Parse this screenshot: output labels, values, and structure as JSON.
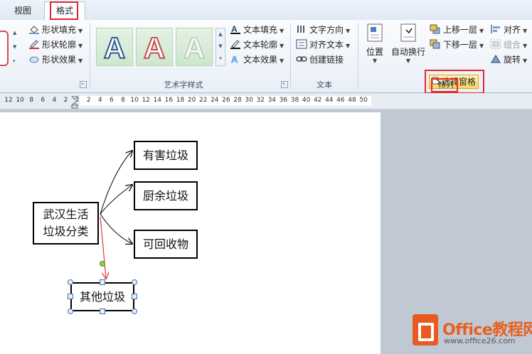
{
  "tabs": {
    "view": "视图",
    "format": "格式"
  },
  "shape_styles": {
    "fill": "形状填充",
    "outline": "形状轮廓",
    "effects": "形状效果"
  },
  "wordart": {
    "group_label": "艺术字样式",
    "sample": "A",
    "text_fill": "文本填充",
    "text_outline": "文本轮廓",
    "text_effects": "文本效果"
  },
  "text_group": {
    "direction": "文字方向",
    "align": "对齐文本",
    "link": "创建链接",
    "group_label": "文本"
  },
  "arrange": {
    "position": "位置",
    "wrap": "自动换行",
    "bring_forward": "上移一层",
    "send_backward": "下移一层",
    "selection_pane": "选择窗格",
    "align": "对齐",
    "group": "组合",
    "rotate": "旋转",
    "group_label": "排列"
  },
  "ruler": {
    "numbers": [
      "12",
      "10",
      "8",
      "6",
      "4",
      "2",
      "2",
      "2",
      "4",
      "6",
      "8",
      "10",
      "12",
      "14",
      "16",
      "18",
      "20",
      "22",
      "24",
      "26",
      "28",
      "30",
      "32",
      "34",
      "36",
      "38",
      "40",
      "42",
      "44",
      "46",
      "48",
      "50"
    ]
  },
  "diagram": {
    "root": "武汉生活\n垃圾分类",
    "nodes": [
      "有害垃圾",
      "厨余垃圾",
      "可回收物",
      "其他垃圾"
    ]
  },
  "watermark": {
    "title": "Office教程网",
    "url": "www.office26.com"
  },
  "colors": {
    "highlight": "#e2282f",
    "accent_orange": "#e8601f"
  }
}
